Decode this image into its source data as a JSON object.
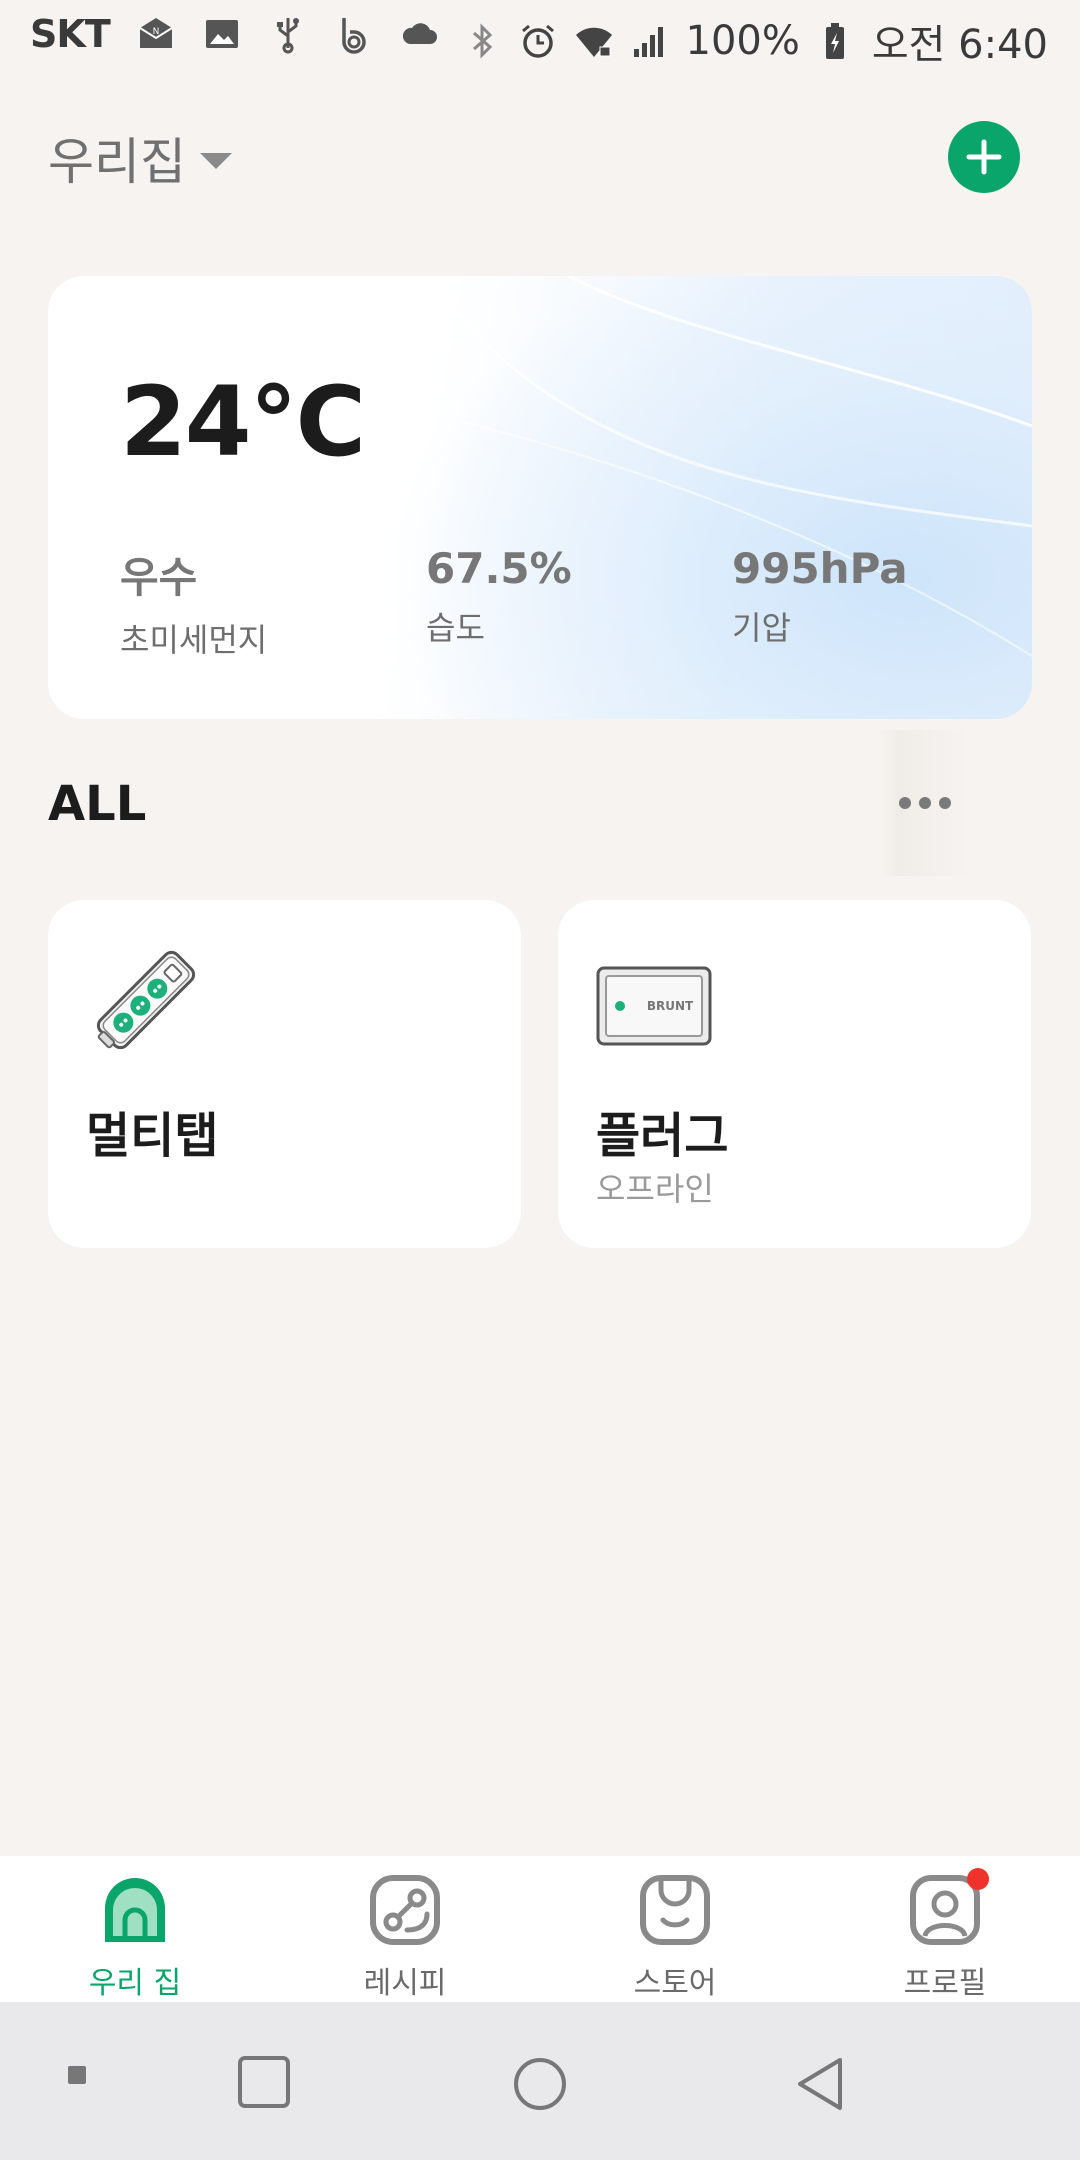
{
  "status_bar": {
    "carrier": "SKT",
    "battery": "100%",
    "time": "오전 6:40"
  },
  "header": {
    "home_name": "우리집"
  },
  "weather": {
    "temperature": "24°C",
    "stats": [
      {
        "value": "우수",
        "label": "초미세먼지"
      },
      {
        "value": "67.5%",
        "label": "습도"
      },
      {
        "value": "995hPa",
        "label": "기압"
      }
    ]
  },
  "section": {
    "title": "ALL"
  },
  "devices": [
    {
      "name": "멀티탭",
      "status": ""
    },
    {
      "name": "플러그",
      "status": "오프라인",
      "brand": "BRUNT"
    }
  ],
  "bottom_nav": {
    "items": [
      {
        "label": "우리 집",
        "icon": "home-icon",
        "active": true
      },
      {
        "label": "레시피",
        "icon": "recipe-icon",
        "active": false
      },
      {
        "label": "스토어",
        "icon": "store-icon",
        "active": false
      },
      {
        "label": "프로필",
        "icon": "profile-icon",
        "active": false
      }
    ]
  },
  "colors": {
    "accent": "#0aa56a",
    "background": "#f7f3f0",
    "badge": "#f0322c"
  }
}
